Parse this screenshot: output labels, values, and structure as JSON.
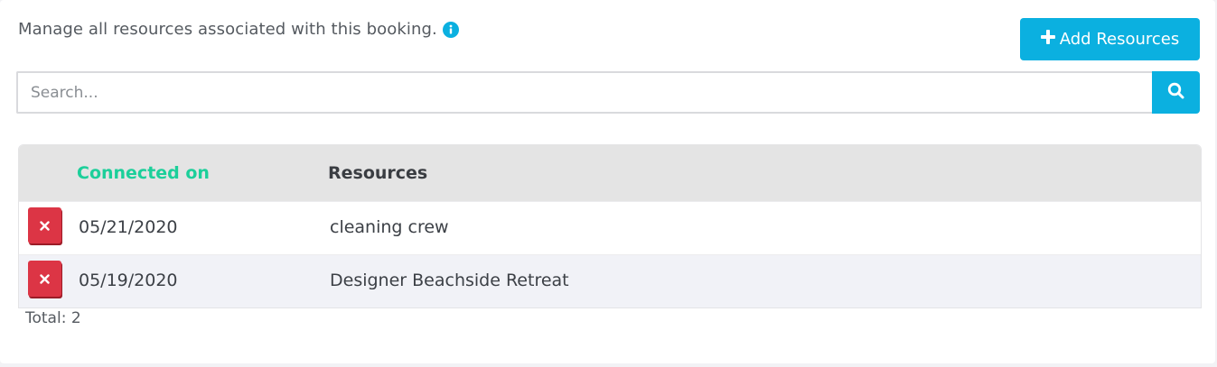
{
  "header": {
    "intro_text": "Manage all resources associated with this booking.",
    "add_button_label": "Add Resources"
  },
  "search": {
    "placeholder": "Search...",
    "value": ""
  },
  "table": {
    "columns": [
      "Connected on",
      "Resources"
    ],
    "rows": [
      {
        "connected_on": "05/21/2020",
        "resource": "cleaning crew"
      },
      {
        "connected_on": "05/19/2020",
        "resource": "Designer Beachside Retreat"
      }
    ]
  },
  "footer": {
    "total_label": "Total: 2"
  },
  "colors": {
    "accent": "#0bb0e0",
    "sorted_header": "#1ccf9a",
    "delete": "#dc3545"
  },
  "icons": [
    "info-icon",
    "plus-icon",
    "search-icon",
    "close-icon"
  ]
}
